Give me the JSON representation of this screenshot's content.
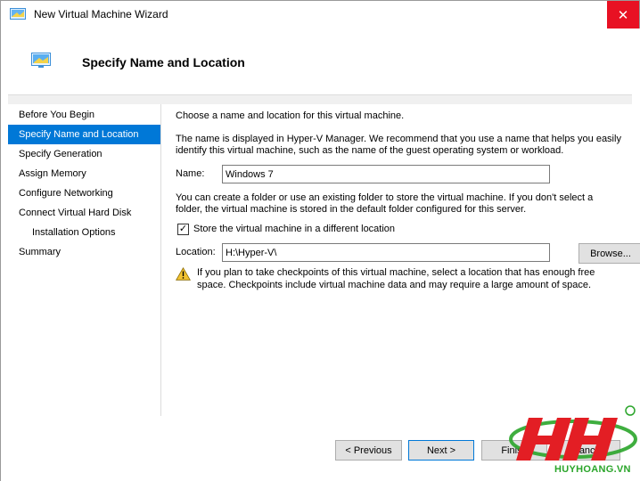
{
  "window": {
    "title": "New Virtual Machine Wizard",
    "close_glyph": "✕"
  },
  "header": {
    "title": "Specify Name and Location"
  },
  "nav": {
    "items": [
      {
        "label": "Before You Begin"
      },
      {
        "label": "Specify Name and Location"
      },
      {
        "label": "Specify Generation"
      },
      {
        "label": "Assign Memory"
      },
      {
        "label": "Configure Networking"
      },
      {
        "label": "Connect Virtual Hard Disk"
      },
      {
        "label": "Installation Options"
      },
      {
        "label": "Summary"
      }
    ],
    "active_index": 1
  },
  "content": {
    "intro": "Choose a name and location for this virtual machine.",
    "name_help_line1": "The name is displayed in Hyper-V Manager. We recommend that you use a name that helps you easily",
    "name_help_line2": "identify this virtual machine, such as the name of the guest operating system or workload.",
    "name_label": "Name:",
    "name_value": "Windows 7",
    "folder_help_line1": "You can create a folder or use an existing folder to store the virtual machine. If you don't select a",
    "folder_help_line2": "folder, the virtual machine is stored in the default folder configured for this server.",
    "store_checkbox_label": "Store the virtual machine in a different location",
    "store_checked": true,
    "location_label": "Location:",
    "location_value": "H:\\Hyper-V\\",
    "browse_label": "Browse...",
    "warning_line1": "If you plan to take checkpoints of this virtual machine, select a location that has enough free",
    "warning_line2": "space. Checkpoints include virtual machine data and may require a large amount of space."
  },
  "footer": {
    "previous_label": "< Previous",
    "next_label": "Next >",
    "finish_label": "Finish",
    "cancel_label": "Cancel"
  },
  "watermark": {
    "text": "HUYHOANG.VN",
    "color_red": "#e31e24",
    "color_green": "#2aa52a"
  },
  "colors": {
    "accent": "#0078d7",
    "close": "#e81123"
  }
}
